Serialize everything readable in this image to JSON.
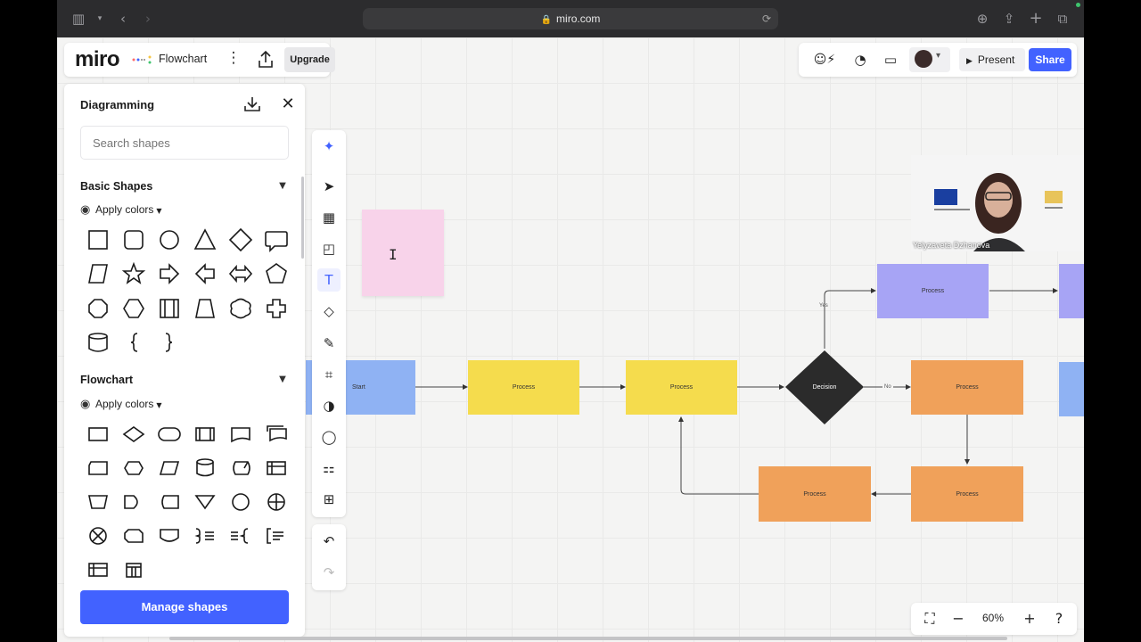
{
  "browser": {
    "url": "miro.com"
  },
  "board": {
    "logo": "miro",
    "title": "Flowchart",
    "upgrade_label": "Upgrade"
  },
  "header_right": {
    "present_label": "Present",
    "share_label": "Share"
  },
  "panel": {
    "title": "Diagramming",
    "search_placeholder": "Search shapes",
    "sections": [
      {
        "title": "Basic Shapes",
        "apply_label": "Apply colors"
      },
      {
        "title": "Flowchart",
        "apply_label": "Apply colors"
      }
    ],
    "manage_label": "Manage shapes"
  },
  "toolbar": {
    "tools": [
      "ai-assist-icon",
      "select-icon",
      "frame-template-icon",
      "sticky-note-icon",
      "text-icon",
      "shapes-icon",
      "pen-icon",
      "frame-icon",
      "color-palette-icon",
      "comment-icon",
      "apps-icon",
      "add-icon"
    ],
    "active": "text-icon"
  },
  "diagram": {
    "nodes": [
      {
        "id": "start",
        "label": "Start",
        "color": "#8fb2f3"
      },
      {
        "id": "p1",
        "label": "Process",
        "color": "#f5dc4d"
      },
      {
        "id": "p2",
        "label": "Process",
        "color": "#f5dc4d"
      },
      {
        "id": "decision",
        "label": "Decision",
        "color": "#2b2b2b"
      },
      {
        "id": "p3",
        "label": "Process",
        "color": "#a7a4f5"
      },
      {
        "id": "p4",
        "label": "Process",
        "color": "#f0a15a"
      },
      {
        "id": "p5",
        "label": "Process",
        "color": "#f0a15a"
      },
      {
        "id": "p6",
        "label": "Process",
        "color": "#f0a15a"
      }
    ],
    "edge_labels": {
      "yes": "Yes",
      "no": "No"
    },
    "sticky_color": "#f8d3ea"
  },
  "video": {
    "participant_name": "Yelyzaveta Dzhanova"
  },
  "zoom": {
    "level": "60%"
  }
}
